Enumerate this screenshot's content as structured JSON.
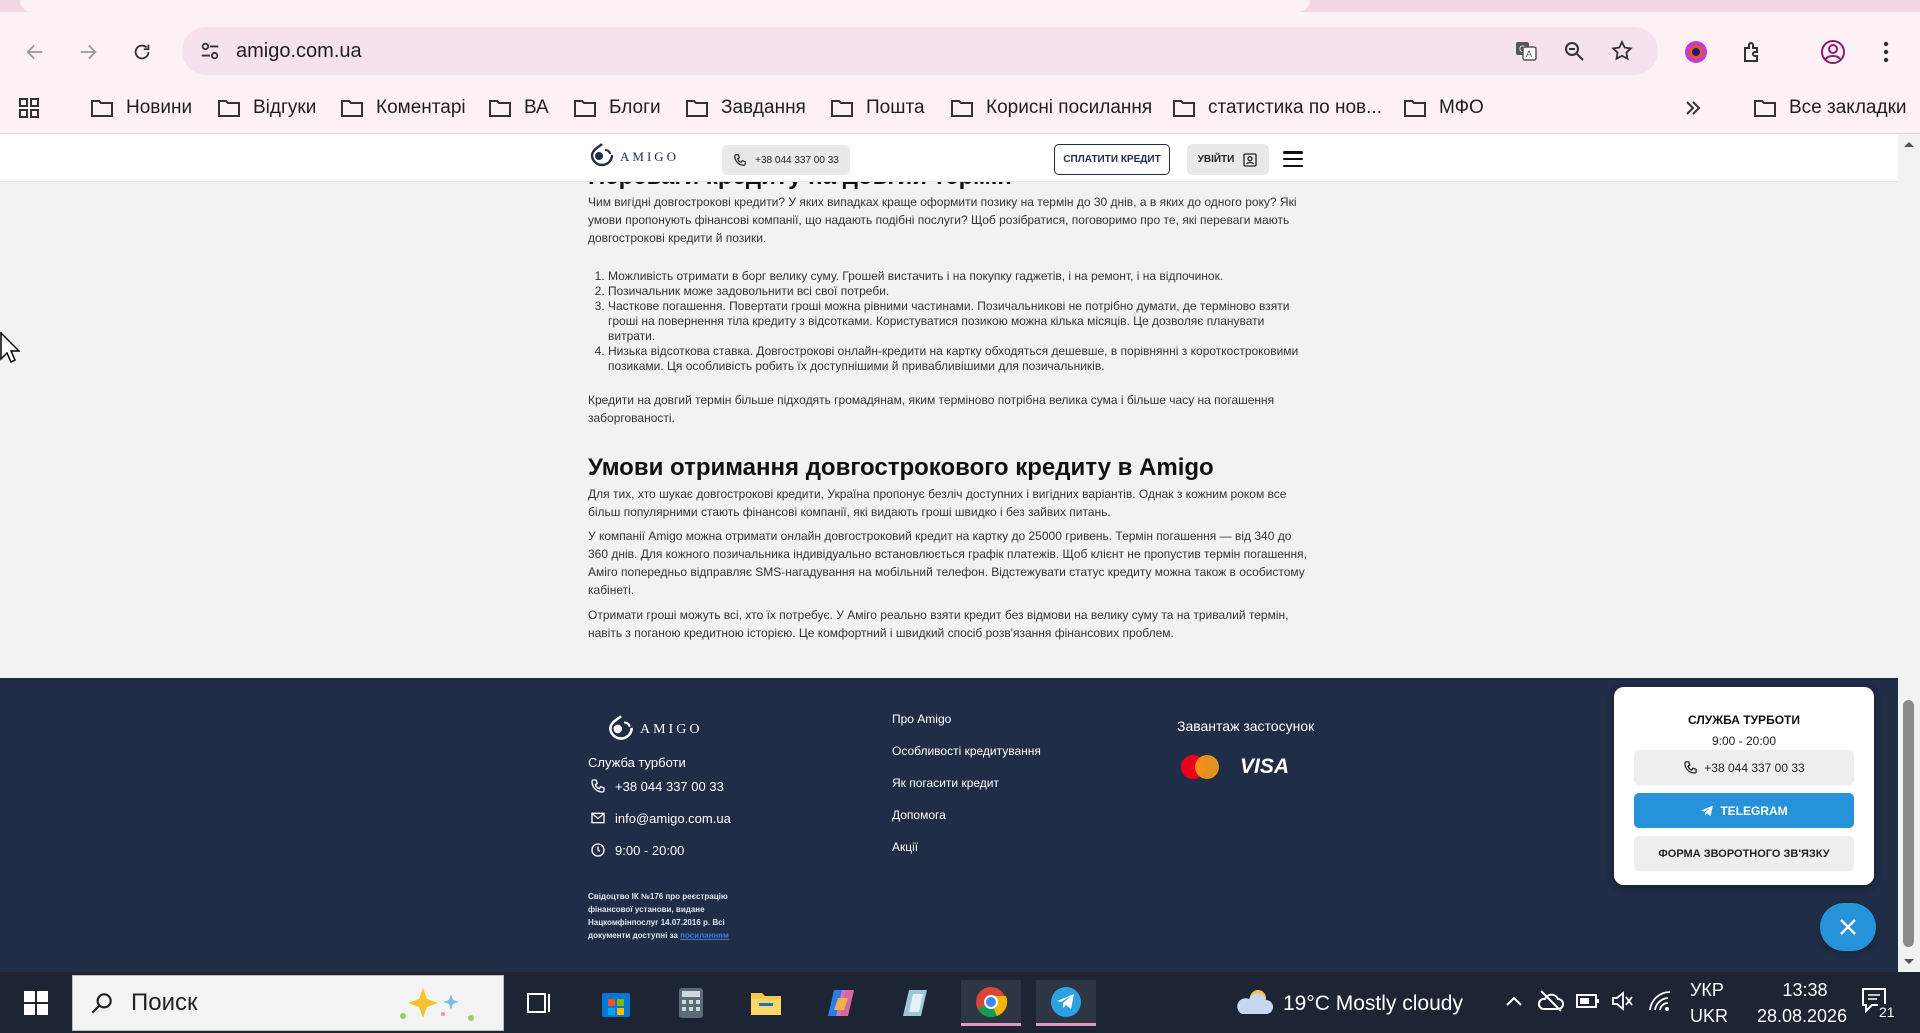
{
  "browser": {
    "url": "amigo.com.ua",
    "bookmarks": [
      "Новини",
      "Відгуки",
      "Коментарі",
      "ВА",
      "Блоги",
      "Завдання",
      "Пошта",
      "Корисні посилання",
      "статистика по нов...",
      "МФО"
    ],
    "all_bookmarks": "Все закладки"
  },
  "site": {
    "logo_text": "AMIGO",
    "phone": "+38 044 337 00 33",
    "pay_button": "СПЛАТИТИ КРЕДИТ",
    "login_button": "УВІЙТИ"
  },
  "article": {
    "heading1": "Переваги кредиту на довгий термін",
    "intro": "Чим вигідні довгострокові кредити? У яких випадках краще оформити позику на термін до 30 днів, а в яких до одного року? Які умови пропонують фінансові компанії, що надають подібні послуги? Щоб розібратися, поговоримо про те, які переваги мають довгострокові кредити й позики.",
    "list": [
      "Можливість отримати в борг велику суму. Грошей вистачить і на покупку гаджетів, і на ремонт, і на відпочинок.",
      "Позичальник може задовольнити всі свої потреби.",
      "Часткове погашення. Повертати гроші можна рівними частинами. Позичальникові не потрібно думати, де терміново взяти гроші на повернення тіла кредиту з відсотками. Користуватися позикою можна кілька місяців. Це дозволяє планувати витрати.",
      "Низька відсоткова ставка. Довгострокові онлайн-кредити на картку обходяться дешевше, в порівнянні з короткостроковими позиками. Ця особливість робить їх доступнішими й привабливішими для позичальників."
    ],
    "after_list": "Кредити на довгий термін більше підходять громадянам, яким терміново потрібна велика сума і більше часу на погашення заборгованості.",
    "heading2": "Умови отримання довгострокового кредиту в Amigo",
    "p1": "Для тих, хто шукає довгострокові кредити, Україна пропонує безліч доступних і вигідних варіантів. Однак з кожним роком все більш популярними стають фінансові компанії, які видають гроші швидко і без зайвих питань.",
    "p2": "У компанії Amigo можна отримати онлайн довгостроковий кредит на картку до 25000 гривень. Термін погашення — від 340 до 360 днів. Для кожного позичальника індивідуально встановлюється графік платежів. Щоб клієнт не пропустив термін погашення, Аміго попередньо відправляє SMS-нагадування на мобільний телефон. Відстежувати статус кредиту можна також в особистому кабінеті.",
    "p3": "Отримати гроші можуть всі, хто їх потребує. У Аміго реально взяти кредит без відмови на велику суму та на тривалий термін, навіть з поганою кредитною історією. Це комфортний і швидкий спосіб розв'язання фінансових проблем."
  },
  "footer": {
    "support_label": "Служба турботи",
    "phone": "+38 044 337 00 33",
    "email": "info@amigo.com.ua",
    "hours": "9:00 - 20:00",
    "legal": "Свідоцтво ІК №176 про реєстрацію фінансової установи, видане Нацкомфінпослуг 14.07.2016 р. Всі документи доступні за",
    "legal_link": "посиланням",
    "links": [
      "Про Amigo",
      "Особливості кредитування",
      "Як погасити кредит",
      "Допомога",
      "Акції"
    ],
    "app_label": "Завантаж застосунок",
    "visa": "VISA"
  },
  "support_widget": {
    "title": "СЛУЖБА ТУРБОТИ",
    "hours": "9:00 - 20:00",
    "phone": "+38 044 337 00 33",
    "telegram": "TELEGRAM",
    "feedback": "ФОРМА ЗВОРОТНОГО ЗВ'ЯЗКУ"
  },
  "taskbar": {
    "search_placeholder": "Поиск",
    "weather": "19°C  Mostly cloudy",
    "lang_top": "УКР",
    "lang_bottom": "UKR",
    "time": "13:38",
    "date": "28.08.2026",
    "notifications": "21"
  },
  "colors": {
    "footer_bg": "#1f2d47",
    "telegram": "#2592d9",
    "chrome_bg": "#fdf1f6"
  }
}
